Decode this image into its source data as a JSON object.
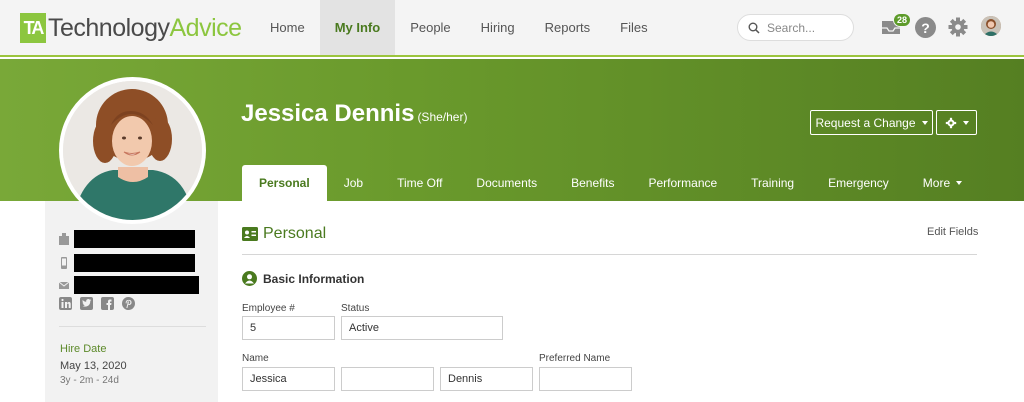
{
  "logo": {
    "mark": "TA",
    "text1": "Technology",
    "text2": "Advice"
  },
  "nav": {
    "items": [
      "Home",
      "My Info",
      "People",
      "Hiring",
      "Reports",
      "Files"
    ],
    "active_index": 1,
    "search_placeholder": "Search...",
    "inbox_badge": "28",
    "help_label": "?"
  },
  "profile": {
    "name": "Jessica Dennis",
    "pronouns": "(She/her)",
    "request_change_label": "Request a Change"
  },
  "tabs": [
    "Personal",
    "Job",
    "Time Off",
    "Documents",
    "Benefits",
    "Performance",
    "Training",
    "Emergency",
    "More"
  ],
  "active_tab": "Personal",
  "sidebar": {
    "hire_date_label": "Hire Date",
    "hire_date": "May 13, 2020",
    "hire_duration": "3y - 2m - 24d"
  },
  "section": {
    "title": "Personal",
    "edit_fields_label": "Edit Fields",
    "subsection_title": "Basic Information"
  },
  "fields": {
    "employee_num_label": "Employee #",
    "employee_num": "5",
    "status_label": "Status",
    "status": "Active",
    "name_label": "Name",
    "first_name": "Jessica",
    "middle_name": "",
    "last_name": "Dennis",
    "preferred_name_label": "Preferred Name",
    "preferred_name": ""
  },
  "colors": {
    "brand_green": "#8cc63f",
    "dark_green": "#4a7a1f",
    "banner_start": "#79a838",
    "banner_end": "#557f22"
  }
}
